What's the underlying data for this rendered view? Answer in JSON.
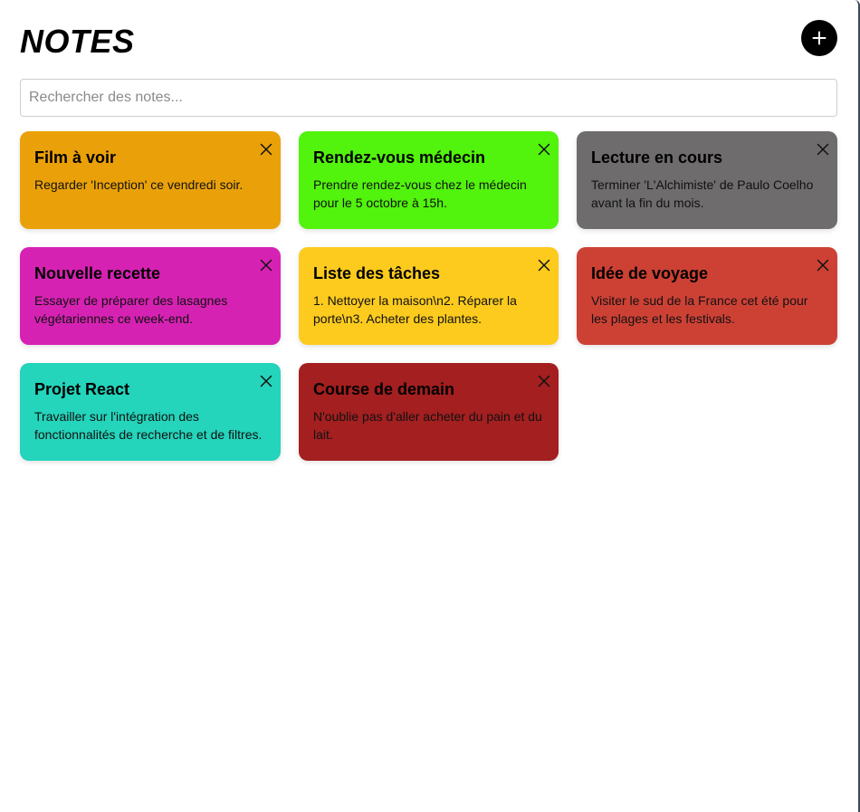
{
  "app": {
    "title": "NOTES",
    "add_label": "+"
  },
  "search": {
    "placeholder": "Rechercher des notes...",
    "value": ""
  },
  "notes": [
    {
      "title": "Film à voir",
      "text": "Regarder 'Inception' ce vendredi soir.",
      "color": "#eaa109"
    },
    {
      "title": "Rendez-vous médecin",
      "text": "Prendre rendez-vous chez le médecin pour le 5 octobre à 15h.",
      "color": "#52f30d"
    },
    {
      "title": "Lecture en cours",
      "text": "Terminer 'L'Alchimiste' de Paulo Coelho avant la fin du mois.",
      "color": "#6e6c6c"
    },
    {
      "title": "Nouvelle recette",
      "text": "Essayer de préparer des lasagnes végétariennes ce week-end.",
      "color": "#d622b3"
    },
    {
      "title": "Liste des tâches",
      "text": "1. Nettoyer la maison\\n2. Réparer la porte\\n3. Acheter des plantes.",
      "color": "#fccb1e"
    },
    {
      "title": "Idée de voyage",
      "text": "Visiter le sud de la France cet été pour les plages et les festivals.",
      "color": "#cd4135"
    },
    {
      "title": "Projet React",
      "text": "Travailler sur l'intégration des fonctionnalités de recherche et de filtres.",
      "color": "#24d4bb"
    },
    {
      "title": "Course de demain",
      "text": "N'oublie pas d'aller acheter du pain et du lait.",
      "color": "#a31f20"
    }
  ],
  "icons": {
    "add": "plus-icon",
    "close": "close-icon"
  }
}
